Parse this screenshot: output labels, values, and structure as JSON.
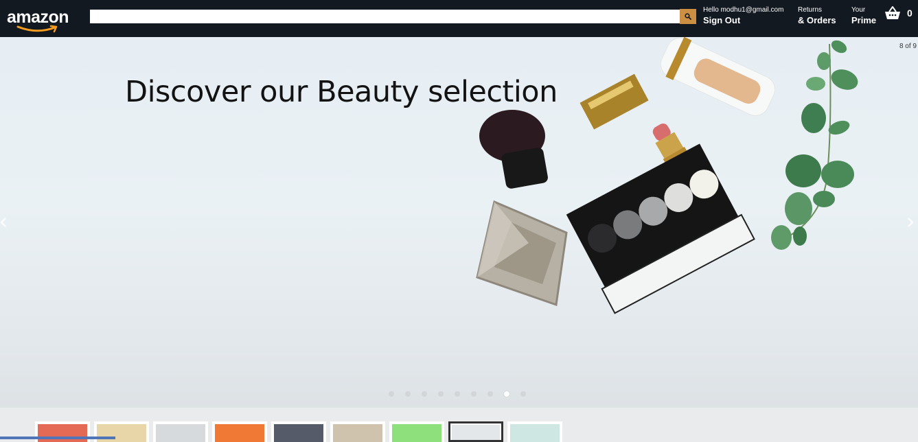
{
  "header": {
    "logo_text": "amazon",
    "search": {
      "value": "",
      "placeholder": ""
    },
    "account": {
      "greeting": "Hello modhu1@gmail.com",
      "action": "Sign Out"
    },
    "orders": {
      "line1": "Returns",
      "line2": "& Orders"
    },
    "prime": {
      "line1": "Your",
      "line2": "Prime"
    },
    "cart": {
      "count": "0",
      "icon": "basket-icon"
    }
  },
  "hero": {
    "title": "Discover our Beauty selection",
    "counter": "8 of 9",
    "prev_icon": "chevron-left-icon",
    "next_icon": "chevron-right-icon",
    "total_slides": 9,
    "active_slide": 8
  },
  "thumbnails": {
    "count": 9,
    "active_index": 7,
    "colors": [
      "#e46a55",
      "#e9d6a8",
      "#d7dadd",
      "#f07a35",
      "#555b68",
      "#cfc3ad",
      "#8ee07c",
      "#e3e7ea",
      "#cfe7e3"
    ]
  },
  "colors": {
    "header_bg": "#131921",
    "search_button": "#cd9042",
    "hero_bg": "#e6eef3"
  }
}
